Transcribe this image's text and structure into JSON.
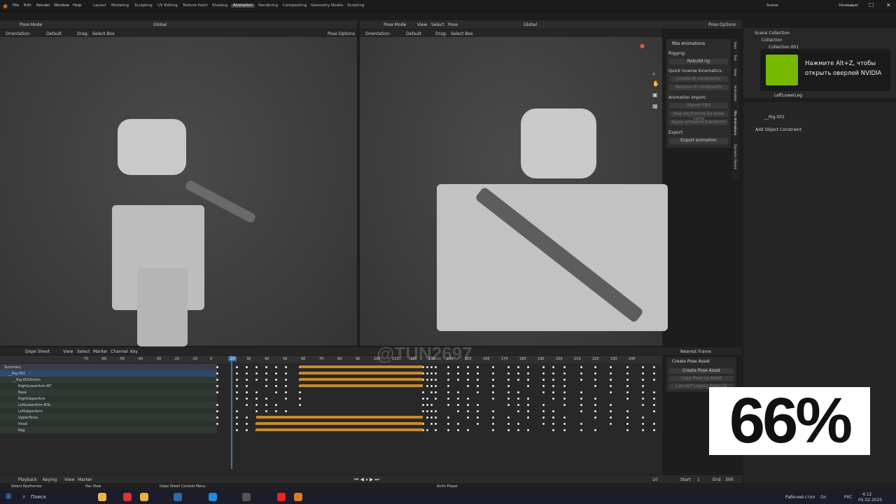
{
  "app": {
    "menus": [
      "File",
      "Edit",
      "Render",
      "Window",
      "Help"
    ],
    "workspaces": [
      "Layout",
      "Modeling",
      "Sculpting",
      "UV Editing",
      "Texture Paint",
      "Shading",
      "Animation",
      "Rendering",
      "Compositing",
      "Geometry Nodes",
      "Scripting"
    ],
    "active_workspace": "Animation",
    "scene": "Scene",
    "view_layer": "ViewLayer"
  },
  "left_view": {
    "mode": "Pose Mode",
    "orientation_label": "Orientation:",
    "orientation": "Default",
    "drag_label": "Drag:",
    "drag": "Select Box",
    "transform": "Global",
    "pose_options": "Pose Options"
  },
  "right_view": {
    "mode": "Pose Mode",
    "menu": [
      "View",
      "Select",
      "Pose"
    ],
    "orientation_label": "Orientation:",
    "orientation": "Default",
    "drag_label": "Drag:",
    "drag": "Select Box",
    "transform": "Global",
    "pose_options": "Pose Options"
  },
  "rbx_panel": {
    "title": "Rbx Animations",
    "rigging": "Rigging:",
    "rebuild": "Rebuild rig",
    "ik_label": "Quick inverse kinematics:",
    "create_ik": "Create IK constraints",
    "remove_ik": "Remove IK constraints",
    "import_label": "Animation import:",
    "import_fbx": "Import FBX",
    "map_keyframes": "Map keyframes by bone name",
    "apply_transform": "Apply armature transform",
    "export_label": "Export:",
    "export_btn": "Export animation",
    "side_tabs": [
      "Item",
      "Tool",
      "View",
      "Animation",
      "Rbx Animations",
      "Dynamic Parent"
    ]
  },
  "outliner": {
    "header": "Scene Collection",
    "collection": "Collection",
    "collection2": "Collection.001",
    "item": "LeftLowerLeg"
  },
  "nvidia": {
    "line1": "Нажмите Alt+Z, чтобы",
    "line2": "открыть оверлей NVIDIA"
  },
  "properties": {
    "object": "__Rig.001",
    "add_constraint": "Add Object Constraint"
  },
  "dopesheet": {
    "editor": "Dope Sheet",
    "menu": [
      "View",
      "Select",
      "Marker",
      "Channel",
      "Key"
    ],
    "snap": "Nearest Frame",
    "current_frame": "10",
    "ruler": [
      "-70",
      "-60",
      "-50",
      "-40",
      "-30",
      "-20",
      "-10",
      "0",
      "10",
      "30",
      "40",
      "50",
      "60",
      "70",
      "80",
      "90",
      "100",
      "110",
      "120",
      "130",
      "140",
      "150",
      "160",
      "170",
      "180",
      "190",
      "200",
      "210",
      "220",
      "230",
      "240"
    ],
    "channels": [
      "Summary",
      "__Rig.001",
      "__Rig.001Action",
      "RightLowerArm-IKT",
      "Base",
      "RightUpperArm",
      "LeftLowerArm-IKTa",
      "LeftUpperArm",
      "UpperTorso",
      "Head",
      "Rag"
    ],
    "pose_library": {
      "title": "Create Pose Asset",
      "create": "Create Pose Asset",
      "copy": "Copy Pose as Asset",
      "legacy": "Convert Legacy Pose Lib"
    }
  },
  "watermark": "@TUN2697",
  "timeline": {
    "menu": [
      "Playback",
      "Keying",
      "View",
      "Marker"
    ],
    "frame": "10",
    "start_label": "Start",
    "start": "1",
    "end_label": "End",
    "end": "300"
  },
  "statusbar": {
    "left1": "Select Keyframes",
    "left2": "Pan View",
    "left3": "Dope Sheet Context Menu",
    "center": "Anim Player"
  },
  "overlay_percent": "66%",
  "taskbar": {
    "search": "Поиск",
    "desktop": "Рабочий стол",
    "on": "On",
    "lang": "РУС",
    "time": "4:12",
    "date": "05.02.2025"
  },
  "colors": {
    "accent": "#4772b3",
    "keyframe_bar": "#c78a2d",
    "nvidia_green": "#76b900",
    "active_tab": "#444444"
  }
}
